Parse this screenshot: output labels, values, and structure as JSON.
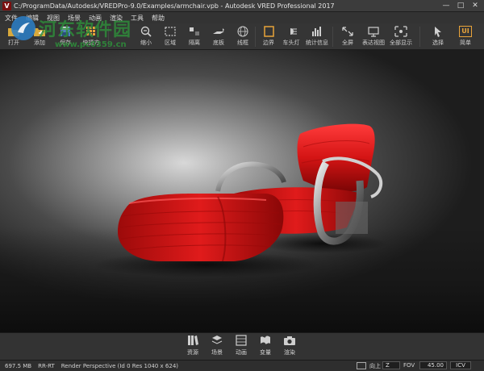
{
  "window": {
    "title": "C:/ProgramData/Autodesk/VREDPro-9.0/Examples/armchair.vpb - Autodesk VRED Professional 2017",
    "logo_letter": "V",
    "controls": [
      "—",
      "□",
      "✕"
    ]
  },
  "menu": [
    "文件",
    "编辑",
    "视图",
    "场景",
    "动画",
    "渲染",
    "工具",
    "帮助"
  ],
  "toolbar": {
    "items": [
      {
        "label": "打开",
        "icon": "open-icon"
      },
      {
        "label": "添加",
        "icon": "add-icon"
      },
      {
        "label": "保存",
        "icon": "save-icon"
      },
      {
        "label": "快捷方",
        "icon": "shortcut-icon"
      },
      {
        "label": "缩小",
        "icon": "zoom-out-icon"
      },
      {
        "label": "区域",
        "icon": "region-icon"
      },
      {
        "label": "隔离",
        "icon": "isolate-icon"
      },
      {
        "label": "底板",
        "icon": "base-plate-icon"
      },
      {
        "label": "线框",
        "icon": "wireframe-icon"
      },
      {
        "label": "边界",
        "icon": "bounds-icon"
      },
      {
        "label": "车头灯",
        "icon": "headlight-icon"
      },
      {
        "label": "统计信息",
        "icon": "statistics-icon"
      },
      {
        "label": "全屏",
        "icon": "fullscreen-icon"
      },
      {
        "label": "表达视图",
        "icon": "presentation-view-icon"
      },
      {
        "label": "全部显示",
        "icon": "show-all-icon"
      },
      {
        "label": "选择",
        "icon": "select-icon"
      },
      {
        "label": "简单",
        "icon": "simple-ui-icon",
        "badge": "UI"
      }
    ]
  },
  "watermark": {
    "line1": "河东软件园",
    "line2": "www.pc0359.cn"
  },
  "dock": [
    {
      "label": "资源",
      "icon": "assets-icon"
    },
    {
      "label": "场景",
      "icon": "scene-icon"
    },
    {
      "label": "动画",
      "icon": "animation-icon"
    },
    {
      "label": "变量",
      "icon": "variants-icon"
    },
    {
      "label": "渲染",
      "icon": "render-camera-icon"
    }
  ],
  "status": {
    "memory": "697.5 MB",
    "renderer": "RR-RT",
    "info": "Render Perspective (Id 0 Res 1040 x 624)",
    "up_label": "向上",
    "up_axis": "Z",
    "fov_label": "FOV",
    "fov_value": "45.00",
    "icv_label": "ICV"
  },
  "colors": {
    "chair_red": "#d41414",
    "accent_orange": "#e8a33a",
    "watermark_green": "#2e8b3a"
  }
}
